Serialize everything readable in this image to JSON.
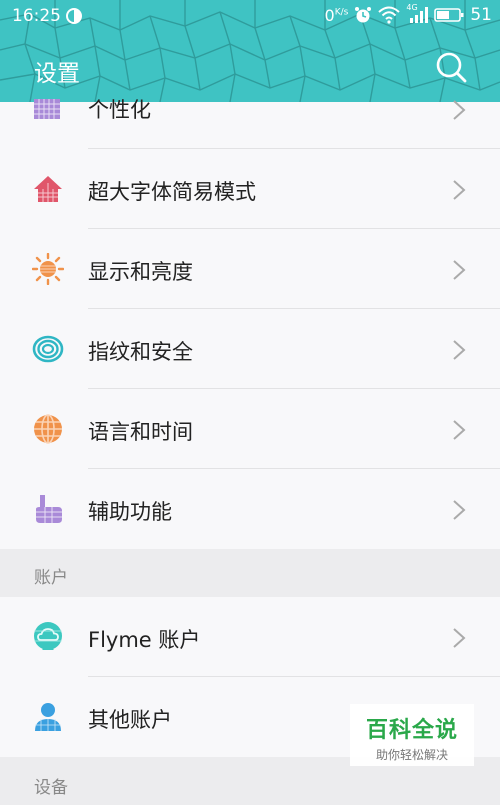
{
  "status_bar": {
    "time": "16:25",
    "speed": "0",
    "speed_unit": "K/s",
    "network": "4G",
    "battery": "51"
  },
  "header": {
    "title": "设置"
  },
  "rows": [
    {
      "label": "个性化",
      "icon": "personalize-icon"
    },
    {
      "label": "超大字体简易模式",
      "icon": "home-icon"
    },
    {
      "label": "显示和亮度",
      "icon": "sun-icon"
    },
    {
      "label": "指纹和安全",
      "icon": "fingerprint-icon"
    },
    {
      "label": "语言和时间",
      "icon": "globe-icon"
    },
    {
      "label": "辅助功能",
      "icon": "hand-icon"
    }
  ],
  "sections": {
    "account": "账户",
    "device": "设备"
  },
  "account_rows": [
    {
      "label": "Flyme 账户",
      "icon": "cloud-icon"
    },
    {
      "label": "其他账户",
      "icon": "person-icon"
    }
  ],
  "watermark": {
    "big": "百科全说",
    "small": "助你轻松解决"
  },
  "colors": {
    "header": "#3fc3c3",
    "accent": "#2aa84a"
  }
}
